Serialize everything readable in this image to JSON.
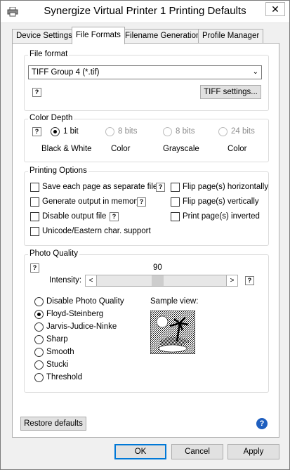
{
  "window": {
    "title": "Synergize Virtual Printer 1 Printing Defaults",
    "close_glyph": "✕"
  },
  "tabs": [
    {
      "label": "Device Settings"
    },
    {
      "label": "File Formats"
    },
    {
      "label": "Filename Generation"
    },
    {
      "label": "Profile Manager"
    }
  ],
  "help_glyph": "?",
  "file_format": {
    "group_title": "File format",
    "selected": "TIFF Group 4 (*.tif)",
    "settings_button": "TIFF settings..."
  },
  "color_depth": {
    "group_title": "Color Depth",
    "options": [
      {
        "label": "1 bit",
        "caption": "Black & White",
        "checked": true,
        "enabled": true
      },
      {
        "label": "8 bits",
        "caption": "Color",
        "checked": false,
        "enabled": false
      },
      {
        "label": "8 bits",
        "caption": "Grayscale",
        "checked": false,
        "enabled": false
      },
      {
        "label": "24 bits",
        "caption": "Color",
        "checked": false,
        "enabled": false
      }
    ]
  },
  "printing_options": {
    "group_title": "Printing Options",
    "left": [
      {
        "label": "Save each page as separate file",
        "checked": false
      },
      {
        "label": "Generate output in memory",
        "checked": false
      },
      {
        "label": "Disable output file",
        "checked": false
      },
      {
        "label": "Unicode/Eastern char. support",
        "checked": false
      }
    ],
    "right": [
      {
        "label": "Flip page(s) horizontally",
        "checked": false
      },
      {
        "label": "Flip page(s) vertically",
        "checked": false
      },
      {
        "label": "Print page(s) inverted",
        "checked": false
      }
    ]
  },
  "photo_quality": {
    "group_title": "Photo Quality",
    "intensity_value": "90",
    "intensity_label": "Intensity:",
    "intensity_fraction": 0.47,
    "options": [
      {
        "label": "Disable Photo Quality",
        "checked": false
      },
      {
        "label": "Floyd-Steinberg",
        "checked": true
      },
      {
        "label": "Jarvis-Judice-Ninke",
        "checked": false
      },
      {
        "label": "Sharp",
        "checked": false
      },
      {
        "label": "Smooth",
        "checked": false
      },
      {
        "label": "Stucki",
        "checked": false
      },
      {
        "label": "Threshold",
        "checked": false
      }
    ],
    "sample_label": "Sample view:"
  },
  "restore_button": "Restore defaults",
  "info_glyph": "?",
  "footer": {
    "ok": "OK",
    "cancel": "Cancel",
    "apply": "Apply"
  }
}
